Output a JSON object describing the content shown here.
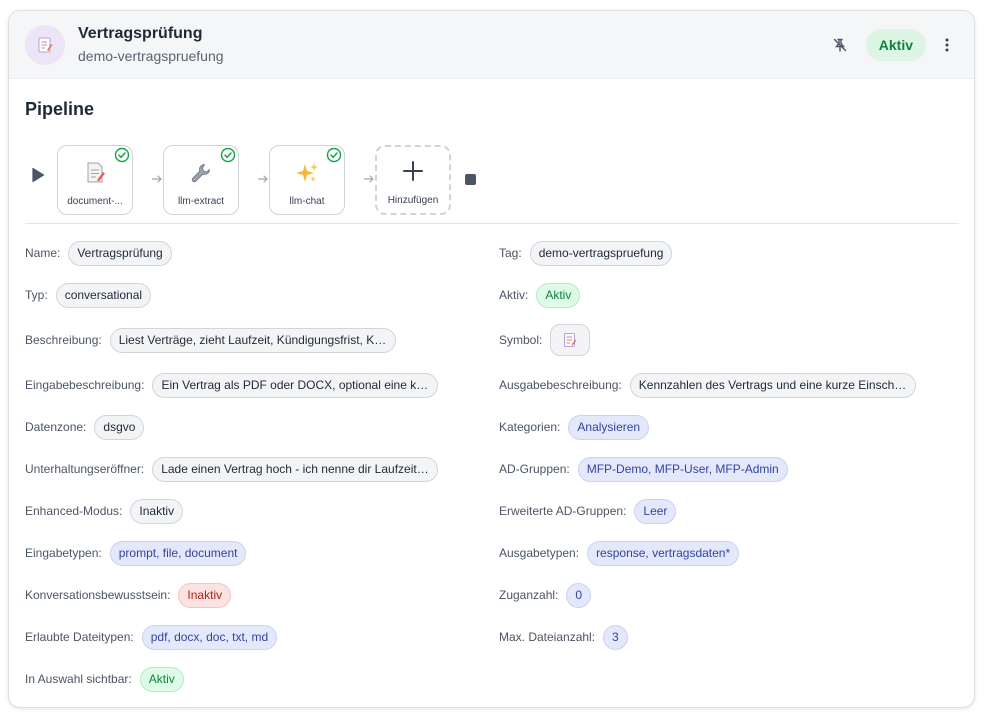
{
  "header": {
    "title": "Vertragsprüfung",
    "subtitle": "demo-vertragspruefung",
    "status": "Aktiv",
    "icon": "document-pencil-icon",
    "colors": {
      "status_bg": "#dcf5e4",
      "status_text": "#15803d",
      "icon_bg": "#ece4f7"
    }
  },
  "pipeline": {
    "title": "Pipeline",
    "steps": [
      {
        "label": "document-...",
        "icon": "document-pencil-icon",
        "status": "success"
      },
      {
        "label": "llm-extract",
        "icon": "wrench-icon",
        "status": "success"
      },
      {
        "label": "llm-chat",
        "icon": "sparkles-icon",
        "status": "success"
      }
    ],
    "add_label": "Hinzufügen"
  },
  "fields": {
    "name": {
      "label": "Name:",
      "value": "Vertragsprüfung"
    },
    "tag": {
      "label": "Tag:",
      "value": "demo-vertragspruefung"
    },
    "typ": {
      "label": "Typ:",
      "value": "conversational"
    },
    "aktiv": {
      "label": "Aktiv:",
      "value": "Aktiv"
    },
    "beschreibung": {
      "label": "Beschreibung:",
      "value": "Liest Verträge, zieht Laufzeit, Kündigungsfrist, Ko..."
    },
    "symbol": {
      "label": "Symbol:",
      "icon": "document-pencil-icon"
    },
    "eingabebeschreibung": {
      "label": "Eingabebeschreibung:",
      "value": "Ein Vertrag als PDF oder DOCX, optional eine ko..."
    },
    "ausgabebeschreibung": {
      "label": "Ausgabebeschreibung:",
      "value": "Kennzahlen des Vertrags und eine kurze Einschät..."
    },
    "datenzone": {
      "label": "Datenzone:",
      "value": "dsgvo"
    },
    "kategorien": {
      "label": "Kategorien:",
      "value": "Analysieren"
    },
    "unterhaltungseroeffner": {
      "label": "Unterhaltungseröffner:",
      "value": "Lade einen Vertrag hoch - ich nenne dir Laufzeit, ..."
    },
    "ad_gruppen": {
      "label": "AD-Gruppen:",
      "value": "MFP-Demo, MFP-User, MFP-Admin"
    },
    "enhanced_modus": {
      "label": "Enhanced-Modus:",
      "value": "Inaktiv"
    },
    "erweiterte_ad_gruppen": {
      "label": "Erweiterte AD-Gruppen:",
      "value": "Leer"
    },
    "eingabetypen": {
      "label": "Eingabetypen:",
      "value": "prompt, file, document"
    },
    "ausgabetypen": {
      "label": "Ausgabetypen:",
      "value": "response, vertragsdaten*"
    },
    "konversationsbewusstsein": {
      "label": "Konversationsbewusstsein:",
      "value": "Inaktiv"
    },
    "zuganzahl": {
      "label": "Zuganzahl:",
      "value": "0"
    },
    "erlaubte_dateitypen": {
      "label": "Erlaubte Dateitypen:",
      "value": "pdf, docx, doc, txt, md"
    },
    "max_dateianzahl": {
      "label": "Max. Dateianzahl:",
      "value": "3"
    },
    "in_auswahl_sichtbar": {
      "label": "In Auswahl sichtbar:",
      "value": "Aktiv"
    }
  }
}
